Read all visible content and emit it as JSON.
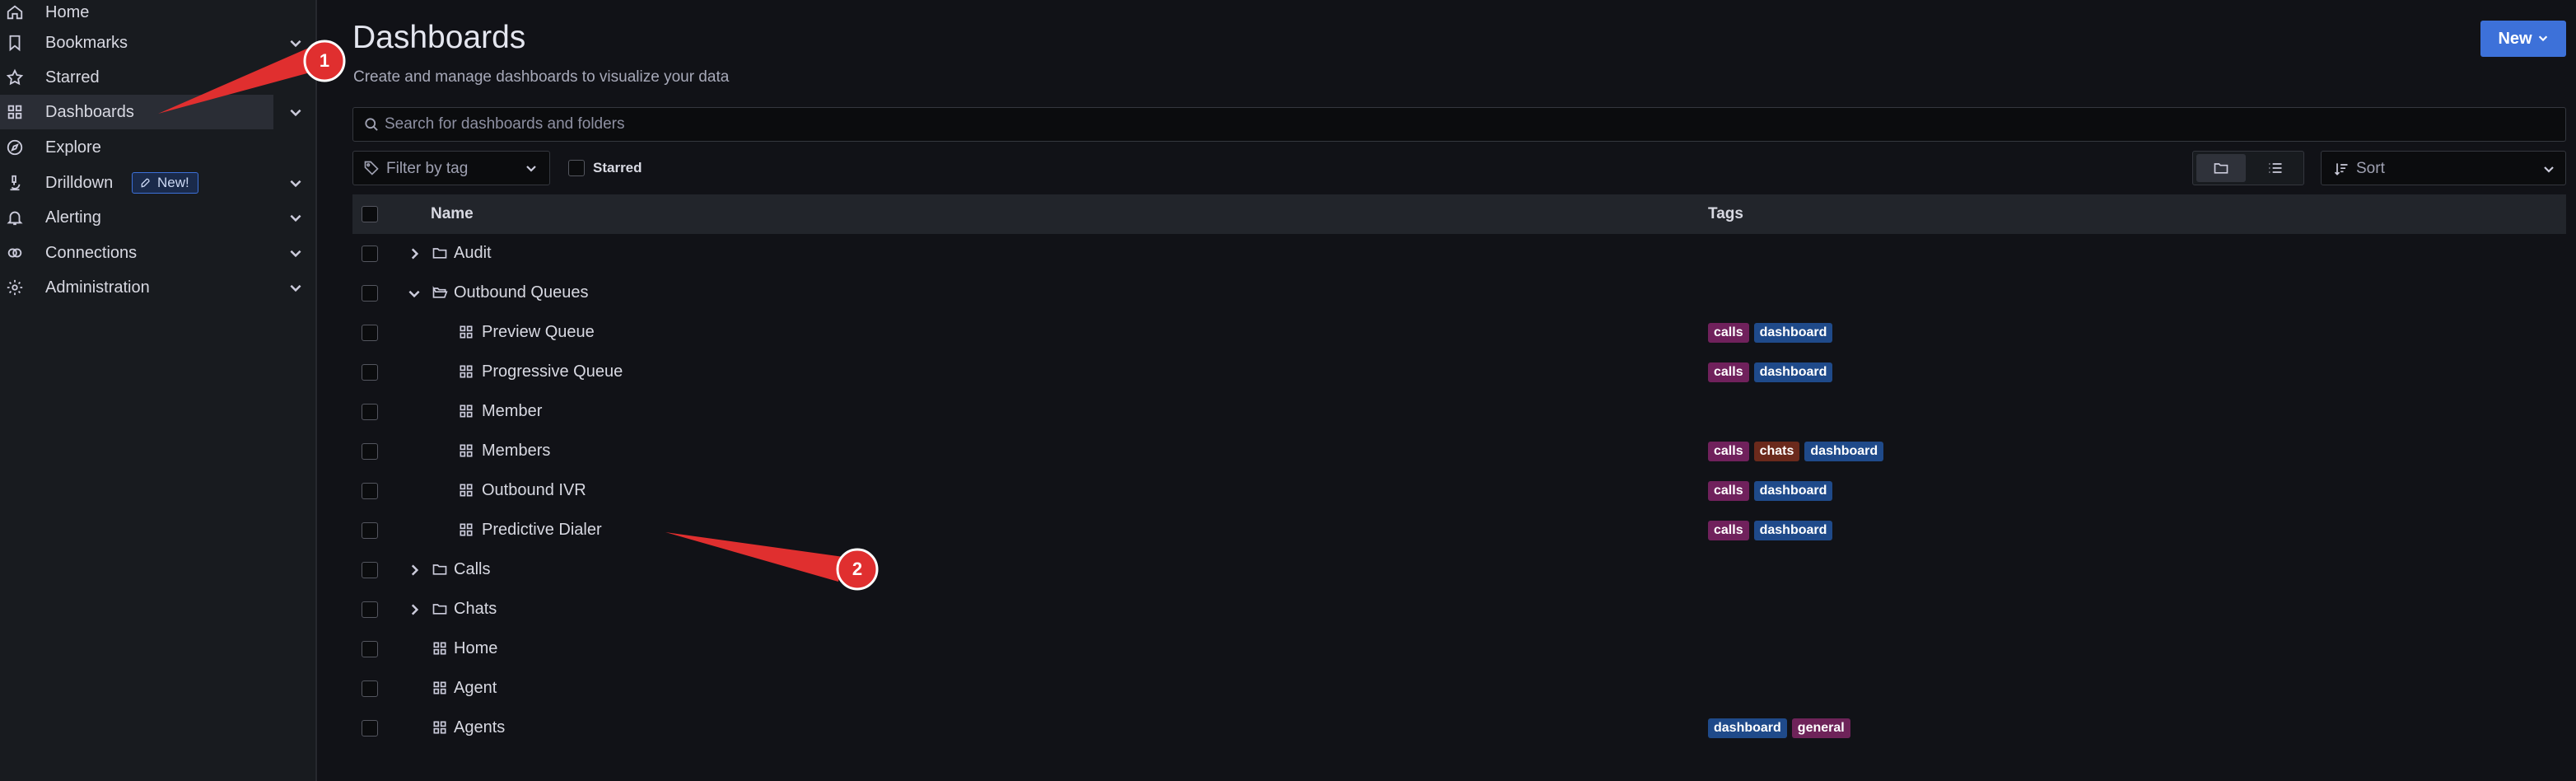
{
  "sidebar": {
    "items": [
      {
        "label": "Home",
        "icon": "home-icon",
        "chevron": false
      },
      {
        "label": "Bookmarks",
        "icon": "bookmark-icon",
        "chevron": true
      },
      {
        "label": "Starred",
        "icon": "star-icon",
        "chevron": false
      },
      {
        "label": "Dashboards",
        "icon": "apps-icon",
        "chevron": true,
        "active": true
      },
      {
        "label": "Explore",
        "icon": "compass-icon",
        "chevron": false
      },
      {
        "label": "Drilldown",
        "icon": "microscope-icon",
        "chevron": true,
        "badge": "New!"
      },
      {
        "label": "Alerting",
        "icon": "bell-icon",
        "chevron": true
      },
      {
        "label": "Connections",
        "icon": "link-icon",
        "chevron": true
      },
      {
        "label": "Administration",
        "icon": "cog-icon",
        "chevron": true
      }
    ]
  },
  "header": {
    "title": "Dashboards",
    "subtitle": "Create and manage dashboards to visualize your data",
    "new_button": "New"
  },
  "search": {
    "placeholder": "Search for dashboards and folders"
  },
  "filters": {
    "tag_placeholder": "Filter by tag",
    "starred_label": "Starred",
    "sort_placeholder": "Sort"
  },
  "table": {
    "columns": {
      "name": "Name",
      "tags": "Tags"
    },
    "rows": [
      {
        "name": "Audit",
        "type": "folder",
        "level": 0,
        "expanded": false,
        "tags": []
      },
      {
        "name": "Outbound Queues",
        "type": "folder",
        "level": 0,
        "expanded": true,
        "tags": []
      },
      {
        "name": "Preview Queue",
        "type": "dashboard",
        "level": 1,
        "tags": [
          "calls",
          "dashboard"
        ]
      },
      {
        "name": "Progressive Queue",
        "type": "dashboard",
        "level": 1,
        "tags": [
          "calls",
          "dashboard"
        ]
      },
      {
        "name": "Member",
        "type": "dashboard",
        "level": 1,
        "tags": []
      },
      {
        "name": "Members",
        "type": "dashboard",
        "level": 1,
        "tags": [
          "calls",
          "chats",
          "dashboard"
        ]
      },
      {
        "name": "Outbound IVR",
        "type": "dashboard",
        "level": 1,
        "tags": [
          "calls",
          "dashboard"
        ]
      },
      {
        "name": "Predictive Dialer",
        "type": "dashboard",
        "level": 1,
        "tags": [
          "calls",
          "dashboard"
        ]
      },
      {
        "name": "Calls",
        "type": "folder",
        "level": 0,
        "expanded": false,
        "tags": []
      },
      {
        "name": "Chats",
        "type": "folder",
        "level": 0,
        "expanded": false,
        "tags": []
      },
      {
        "name": "Home",
        "type": "dashboard",
        "level": 0,
        "tags": []
      },
      {
        "name": "Agent",
        "type": "dashboard",
        "level": 0,
        "tags": []
      },
      {
        "name": "Agents",
        "type": "dashboard",
        "level": 0,
        "tags": [
          "dashboard",
          "general"
        ]
      }
    ]
  },
  "tag_colors": {
    "calls": "#70215c",
    "dashboard": "#1f4a8a",
    "chats": "#6b2a1c",
    "general": "#6e2359"
  },
  "annotations": {
    "marker_1": "1",
    "marker_2": "2",
    "color": "#e02f2f"
  }
}
